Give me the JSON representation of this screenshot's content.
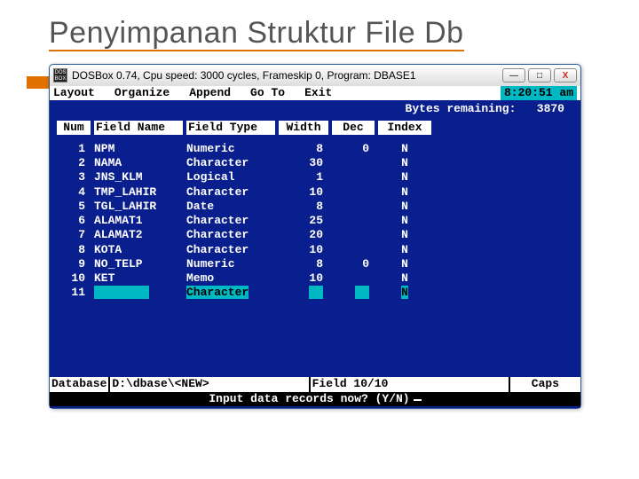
{
  "slide": {
    "title": "Penyimpanan Struktur File Db"
  },
  "window": {
    "title": "DOSBox 0.74, Cpu speed:    3000 cycles, Frameskip  0, Program:  DBASE1",
    "icon_label": "DOS\nBOX",
    "buttons": {
      "min": "—",
      "max": "□",
      "close": "X"
    }
  },
  "menu": [
    "Layout",
    "Organize",
    "Append",
    "Go To",
    "Exit"
  ],
  "clock": "8:20:51 am",
  "status": {
    "bytes_label": "Bytes remaining:",
    "bytes_value": "3870"
  },
  "columns": [
    "Num",
    "Field Name",
    "Field Type",
    "Width",
    "Dec",
    "Index"
  ],
  "rows": [
    {
      "num": "1",
      "name": "NPM",
      "type": "Numeric",
      "width": "8",
      "dec": "0",
      "index": "N"
    },
    {
      "num": "2",
      "name": "NAMA",
      "type": "Character",
      "width": "30",
      "dec": "",
      "index": "N"
    },
    {
      "num": "3",
      "name": "JNS_KLM",
      "type": "Logical",
      "width": "1",
      "dec": "",
      "index": "N"
    },
    {
      "num": "4",
      "name": "TMP_LAHIR",
      "type": "Character",
      "width": "10",
      "dec": "",
      "index": "N"
    },
    {
      "num": "5",
      "name": "TGL_LAHIR",
      "type": "Date",
      "width": "8",
      "dec": "",
      "index": "N"
    },
    {
      "num": "6",
      "name": "ALAMAT1",
      "type": "Character",
      "width": "25",
      "dec": "",
      "index": "N"
    },
    {
      "num": "7",
      "name": "ALAMAT2",
      "type": "Character",
      "width": "20",
      "dec": "",
      "index": "N"
    },
    {
      "num": "8",
      "name": "KOTA",
      "type": "Character",
      "width": "10",
      "dec": "",
      "index": "N"
    },
    {
      "num": "9",
      "name": "NO_TELP",
      "type": "Numeric",
      "width": "8",
      "dec": "0",
      "index": "N"
    },
    {
      "num": "10",
      "name": "KET",
      "type": "Memo",
      "width": "10",
      "dec": "",
      "index": "N"
    }
  ],
  "edit_row": {
    "num": "11",
    "name": "        ",
    "type": "Character",
    "width": "  ",
    "dec": "  ",
    "index": "N"
  },
  "bottom": {
    "database_label": "Database",
    "path": "D:\\dbase\\<NEW>",
    "field": "Field 10/10",
    "caps": "Caps",
    "prompt": "Input data records now? (Y/N)"
  }
}
